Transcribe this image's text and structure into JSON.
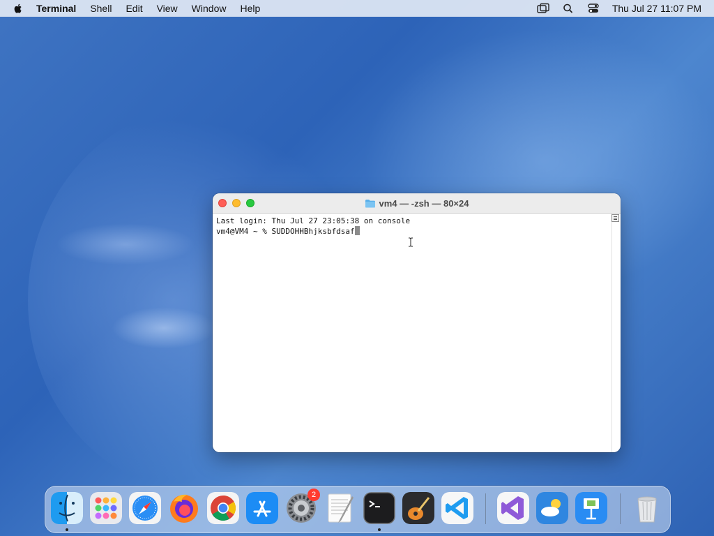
{
  "menubar": {
    "app_name": "Terminal",
    "items": [
      "Shell",
      "Edit",
      "View",
      "Window",
      "Help"
    ],
    "clock": "Thu Jul 27  11:07 PM"
  },
  "window": {
    "title": "vm4 — -zsh — 80×24",
    "lines": [
      "Last login: Thu Jul 27 23:05:38 on console",
      "vm4@VM4 ~ % SUDDOHHBhjksbfdsaf"
    ]
  },
  "dock": {
    "apps": [
      "finder-icon",
      "launchpad-icon",
      "safari-icon",
      "firefox-icon",
      "chrome-icon",
      "app-store-icon",
      "system-settings-icon",
      "textedit-icon",
      "terminal-icon",
      "garageband-icon",
      "vscode-icon",
      "visual-studio-icon",
      "weather-icon",
      "keynote-icon",
      "trash-icon"
    ],
    "settings_badge": "2"
  },
  "colors": {
    "close": "#ff5f57",
    "minimize": "#febc2e",
    "maximize": "#28c840"
  }
}
